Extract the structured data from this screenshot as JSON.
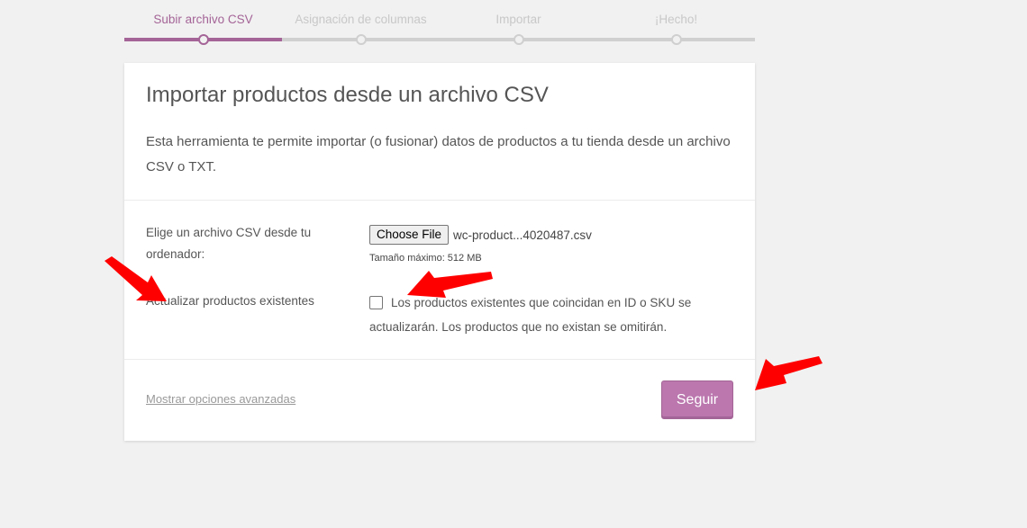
{
  "stepper": {
    "steps": [
      {
        "label": "Subir archivo CSV",
        "active": true
      },
      {
        "label": "Asignación de columnas",
        "active": false
      },
      {
        "label": "Importar",
        "active": false
      },
      {
        "label": "¡Hecho!",
        "active": false
      }
    ]
  },
  "card": {
    "title": "Importar productos desde un archivo CSV",
    "description": "Esta herramienta te permite importar (o fusionar) datos de productos a tu tienda desde un archivo CSV o TXT.",
    "file_field": {
      "label": "Elige un archivo CSV desde tu ordenador:",
      "button_label": "Choose File",
      "file_name": "wc-product...4020487.csv",
      "max_size": "Tamaño máximo: 512 MB"
    },
    "update_field": {
      "label": "Actualizar productos existentes",
      "checked": false,
      "description": "Los productos existentes que coincidan en ID o SKU se actualizarán. Los productos que no existan se omitirán."
    },
    "footer": {
      "advanced_link": "Mostrar opciones avanzadas",
      "continue_button": "Seguir"
    }
  },
  "colors": {
    "accent": "#a46497",
    "button": "#bb77ae",
    "annotation_arrow": "#ff0000"
  }
}
